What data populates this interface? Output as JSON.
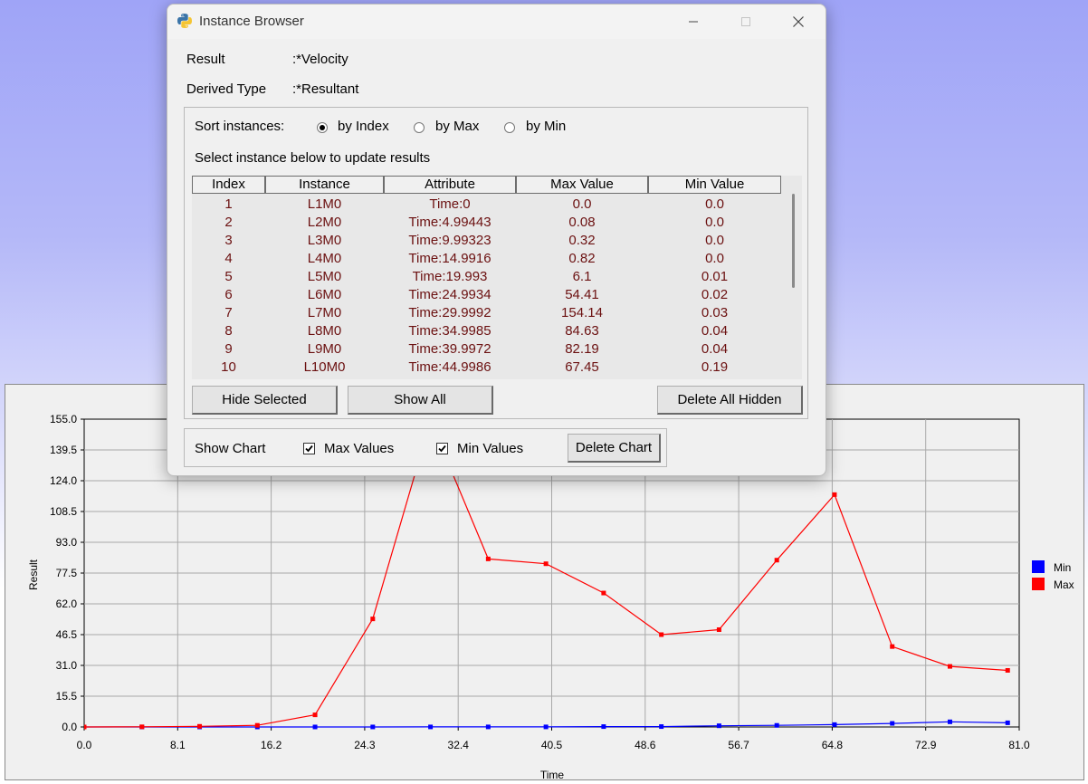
{
  "dialog": {
    "title": "Instance Browser",
    "result_label": "Result",
    "result_value": ":*Velocity",
    "derived_label": "Derived Type",
    "derived_value": ":*Resultant",
    "sort_label": "Sort instances:",
    "sort_options": [
      "by Index",
      "by Max",
      "by Min"
    ],
    "sort_selected": "by Index",
    "select_hint": "Select instance below to update results",
    "table": {
      "columns": [
        "Index",
        "Instance",
        "Attribute",
        "Max Value",
        "Min Value"
      ],
      "rows": [
        [
          "1",
          "L1M0",
          "Time:0",
          "0.0",
          "0.0"
        ],
        [
          "2",
          "L2M0",
          "Time:4.99443",
          "0.08",
          "0.0"
        ],
        [
          "3",
          "L3M0",
          "Time:9.99323",
          "0.32",
          "0.0"
        ],
        [
          "4",
          "L4M0",
          "Time:14.9916",
          "0.82",
          "0.0"
        ],
        [
          "5",
          "L5M0",
          "Time:19.993",
          "6.1",
          "0.01"
        ],
        [
          "6",
          "L6M0",
          "Time:24.9934",
          "54.41",
          "0.02"
        ],
        [
          "7",
          "L7M0",
          "Time:29.9992",
          "154.14",
          "0.03"
        ],
        [
          "8",
          "L8M0",
          "Time:34.9985",
          "84.63",
          "0.04"
        ],
        [
          "9",
          "L9M0",
          "Time:39.9972",
          "82.19",
          "0.04"
        ],
        [
          "10",
          "L10M0",
          "Time:44.9986",
          "67.45",
          "0.19"
        ]
      ]
    },
    "buttons": {
      "hide_selected": "Hide Selected",
      "show_all": "Show All",
      "delete_all_hidden": "Delete All Hidden",
      "delete_chart": "Delete Chart"
    },
    "show_chart_label": "Show Chart",
    "max_values_label": "Max Values",
    "min_values_label": "Min Values",
    "max_values_checked": true,
    "min_values_checked": true
  },
  "chart_data": {
    "type": "line",
    "title": "",
    "xlabel": "Time",
    "ylabel": "Result",
    "xlim": [
      0,
      81
    ],
    "ylim": [
      0,
      155
    ],
    "xticks": [
      "0.0",
      "8.1",
      "16.2",
      "24.3",
      "32.4",
      "40.5",
      "48.6",
      "56.7",
      "64.8",
      "72.9",
      "81.0"
    ],
    "yticks": [
      "0.0",
      "15.5",
      "31.0",
      "46.5",
      "62.0",
      "77.5",
      "93.0",
      "108.5",
      "124.0",
      "139.5",
      "155.0"
    ],
    "grid": true,
    "legend_position": "right",
    "series": [
      {
        "name": "Min",
        "color": "#0000ff",
        "x": [
          0,
          5.0,
          10.0,
          15.0,
          20.0,
          25.0,
          30.0,
          35.0,
          40.0,
          45.0,
          50.0,
          55.0,
          60.0,
          65.0,
          70.0,
          75.0,
          80.0
        ],
        "y": [
          0.0,
          0.0,
          0.0,
          0.0,
          0.01,
          0.02,
          0.03,
          0.04,
          0.04,
          0.19,
          0.2,
          0.6,
          0.8,
          1.2,
          1.8,
          2.6,
          2.1
        ]
      },
      {
        "name": "Max",
        "color": "#ff0000",
        "x": [
          0,
          5.0,
          10.0,
          15.0,
          20.0,
          25.0,
          30.0,
          35.0,
          40.0,
          45.0,
          50.0,
          55.0,
          60.0,
          65.0,
          70.0,
          75.0,
          80.0
        ],
        "y": [
          0.0,
          0.08,
          0.32,
          0.82,
          6.1,
          54.41,
          154.14,
          84.63,
          82.19,
          67.45,
          46.5,
          49.0,
          84.0,
          117.0,
          40.5,
          30.5,
          28.5
        ]
      }
    ]
  }
}
